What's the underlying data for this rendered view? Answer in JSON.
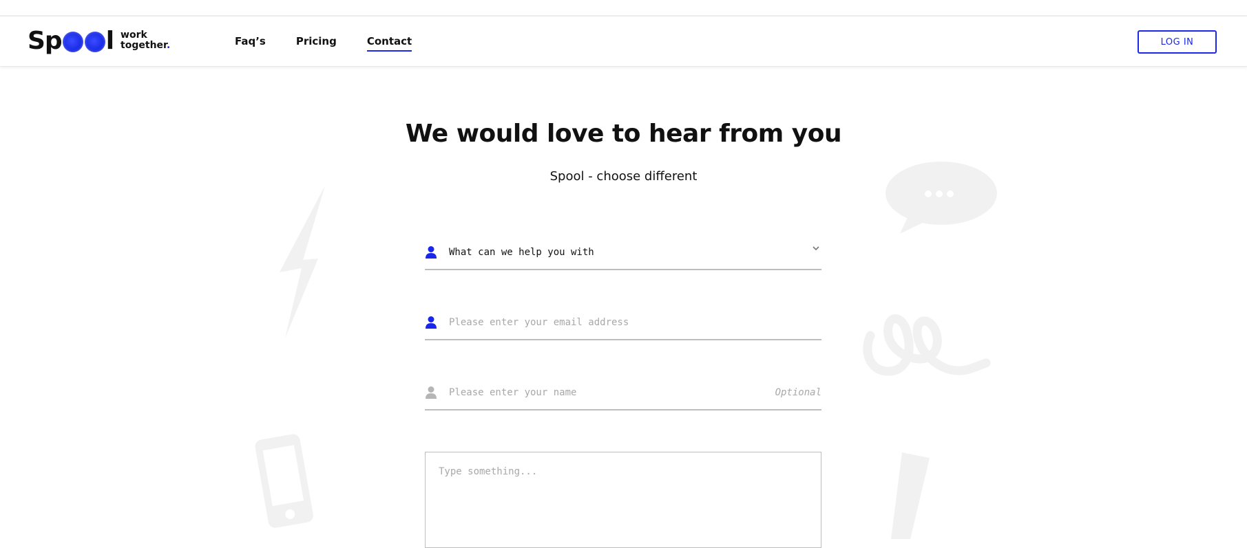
{
  "brand": {
    "name": "Spool",
    "tagline_line1": "work",
    "tagline_line2": "together",
    "tagline_dot": "."
  },
  "nav": {
    "links": [
      {
        "label": "Faq’s",
        "active": false
      },
      {
        "label": "Pricing",
        "active": false
      },
      {
        "label": "Contact",
        "active": true
      }
    ],
    "login_label": "LOG IN"
  },
  "hero": {
    "title": "We would love to hear from you",
    "subtitle": "Spool - choose different"
  },
  "form": {
    "topic": {
      "value": "What can we help you with",
      "icon": "user-icon"
    },
    "email": {
      "placeholder": "Please enter your email address",
      "icon": "user-icon"
    },
    "name": {
      "placeholder": "Please enter your name",
      "optional_label": "Optional",
      "icon": "user-icon"
    },
    "message": {
      "placeholder": "Type something..."
    }
  },
  "colors": {
    "accent": "#1a26e8",
    "icon_inactive": "#b5b5b5",
    "decor": "#f1f1f1"
  }
}
